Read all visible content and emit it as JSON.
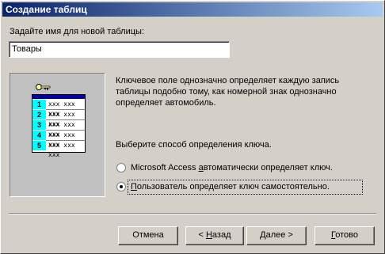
{
  "window": {
    "title": "Создание таблиц"
  },
  "name_prompt": "Задайте имя для новой таблицы:",
  "table_name": "Товары",
  "illustration": {
    "rows": [
      "1",
      "2",
      "3",
      "4",
      "5"
    ],
    "cell_text": "xxx xxx xxx"
  },
  "description": "Ключевое поле однозначно определяет каждую запись таблицы подобно тому, как номерной знак однозначно определяет автомобиль.",
  "key_prompt": "Выберите способ определения ключа.",
  "options": [
    {
      "label_pre": "Microsoft Access ",
      "label_ul": "а",
      "label_post": "втоматически определяет ключ.",
      "selected": false
    },
    {
      "label_pre": "",
      "label_ul": "П",
      "label_post": "ользователь определяет ключ самостоятельно.",
      "selected": true
    }
  ],
  "buttons": {
    "cancel": "Отмена",
    "back_pre": "< ",
    "back_ul": "Н",
    "back_post": "азад",
    "next_pre": "",
    "next_ul": "Д",
    "next_post": "алее >",
    "finish_pre": "",
    "finish_ul": "Г",
    "finish_post": "отово"
  }
}
